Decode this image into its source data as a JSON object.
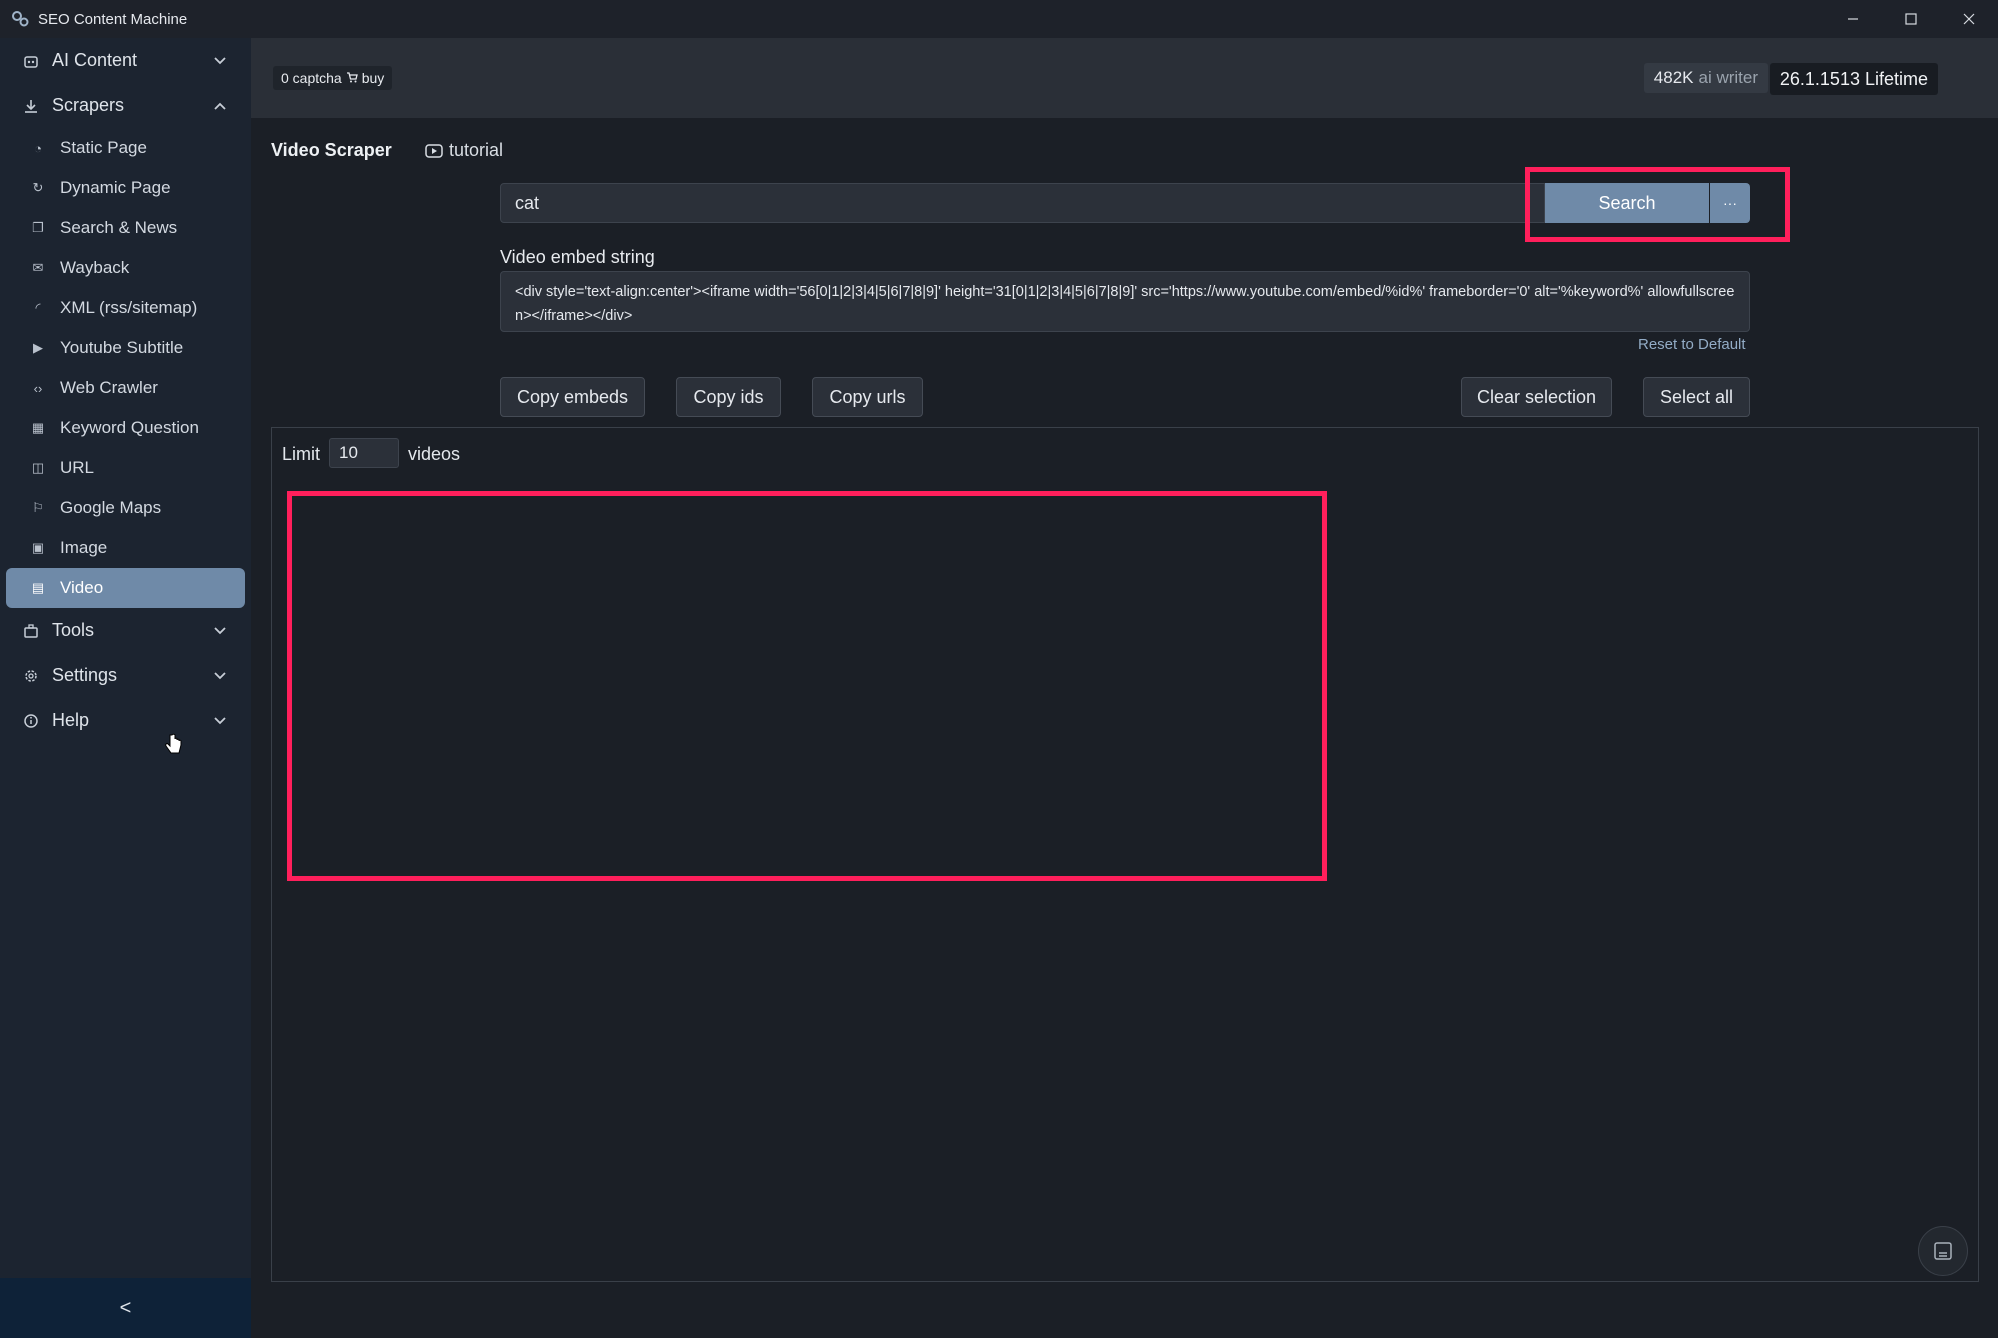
{
  "window": {
    "title": "SEO Content Machine",
    "controls": [
      "minimize",
      "maximize",
      "close"
    ]
  },
  "topbar": {
    "captcha_text": "0 captcha",
    "buy_label": "buy",
    "writer_count": "482K",
    "writer_label": "ai writer",
    "version": "26.1.1513 Lifetime"
  },
  "sidebar": {
    "sections": {
      "ai_content": "AI Content",
      "scrapers": "Scrapers",
      "tools": "Tools",
      "settings": "Settings",
      "help": "Help"
    },
    "items": [
      {
        "label": "Static Page",
        "icon": "gauge-icon"
      },
      {
        "label": "Dynamic Page",
        "icon": "refresh-icon"
      },
      {
        "label": "Search & News",
        "icon": "copy-icon"
      },
      {
        "label": "Wayback",
        "icon": "mail-icon"
      },
      {
        "label": "XML (rss/sitemap)",
        "icon": "rss-icon"
      },
      {
        "label": "Youtube Subtitle",
        "icon": "play-icon"
      },
      {
        "label": "Web Crawler",
        "icon": "code-icon"
      },
      {
        "label": "Keyword Question",
        "icon": "grid-icon"
      },
      {
        "label": "URL",
        "icon": "columns-icon"
      },
      {
        "label": "Google Maps",
        "icon": "map-icon"
      },
      {
        "label": "Image",
        "icon": "image-icon"
      },
      {
        "label": "Video",
        "icon": "film-icon",
        "active": true
      }
    ],
    "collapse_glyph": "<"
  },
  "main": {
    "title": "Video Scraper",
    "tutorial_label": "tutorial",
    "search_value": "cat",
    "search_button": "Search",
    "more_button": "···",
    "embed_label": "Video embed string",
    "embed_value": "<div style='text-align:center'><iframe width='56[0|1|2|3|4|5|6|7|8|9]' height='31[0|1|2|3|4|5|6|7|8|9]' src='https://www.youtube.com/embed/%id%' frameborder='0' alt='%keyword%' allowfullscreen></iframe></div>",
    "reset_label": "Reset to Default",
    "buttons": {
      "copy_embeds": "Copy embeds",
      "copy_ids": "Copy ids",
      "copy_urls": "Copy urls",
      "clear_selection": "Clear selection",
      "select_all": "Select all"
    },
    "limit_label": "Limit",
    "limit_value": "10",
    "videos_label": "videos"
  },
  "colors": {
    "accent": "#6f8aa8",
    "highlight": "#ff1f5b",
    "sidebar_bg": "#1c2430",
    "content_bg": "#1b1f26"
  }
}
